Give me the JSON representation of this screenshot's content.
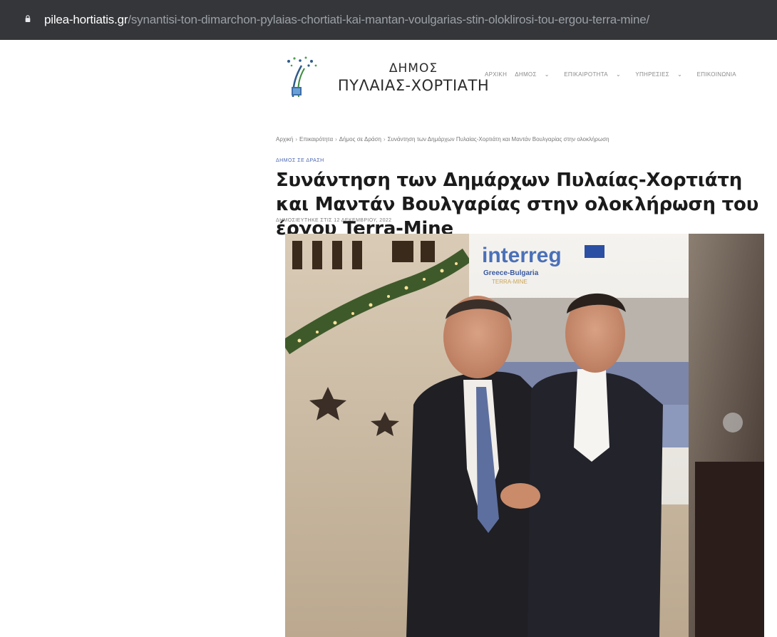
{
  "browser": {
    "url_domain": "pilea-hortiatis.gr",
    "url_path": "/synantisi-ton-dimarchon-pylaias-chortiati-kai-mantan-voulgarias-stin-oloklirosi-tou-ergou-terra-mine/"
  },
  "site": {
    "name_line1": "ΔΗΜΟΣ",
    "name_line2": "ΠΥΛΑΙΑΣ-ΧΟΡΤΙΑΤΗ",
    "nav": [
      {
        "label": "ΑΡΧΙΚΗ"
      },
      {
        "label": "ΔΗΜΟΣ",
        "caret": "⌄"
      },
      {
        "label": "ΕΠΙΚΑΙΡΟΤΗΤΑ",
        "caret": "⌄"
      },
      {
        "label": "ΥΠΗΡΕΣΙΕΣ",
        "caret": "⌄"
      },
      {
        "label": "ΕΠΙΚΟΙΝΩΝΙΑ"
      }
    ]
  },
  "article": {
    "breadcrumb": [
      "Αρχική",
      "Επικαιρότητα",
      "Δήμος σε Δράση",
      "Συνάντηση των Δημάρχων Πυλαίας-Χορτιάτη και Μαντάν Βουλγαρίας στην ολοκλήρωση"
    ],
    "category": "ΔΗΜΟΣ ΣΕ ΔΡΑΣΗ",
    "title": "Συνάντηση των Δημάρχων Πυλαίας-Χορτιάτη και Μαντάν Βουλγαρίας στην ολοκλήρωση του έργου Terra-Mine",
    "published": "ΔΗΜΟΣΙΕΥΤΗΚΕ ΣΤΙΣ 12 ΔΕΚΕΜΒΡΙΟΥ, 2022"
  },
  "photo": {
    "banner_brand": "interreg",
    "banner_line1": "Greece-Bulgaria",
    "banner_line2": "TERRA-MINE"
  },
  "colors": {
    "addressbar_bg": "#35363a",
    "category": "#4a66b0",
    "headline": "#1b1b1b"
  }
}
